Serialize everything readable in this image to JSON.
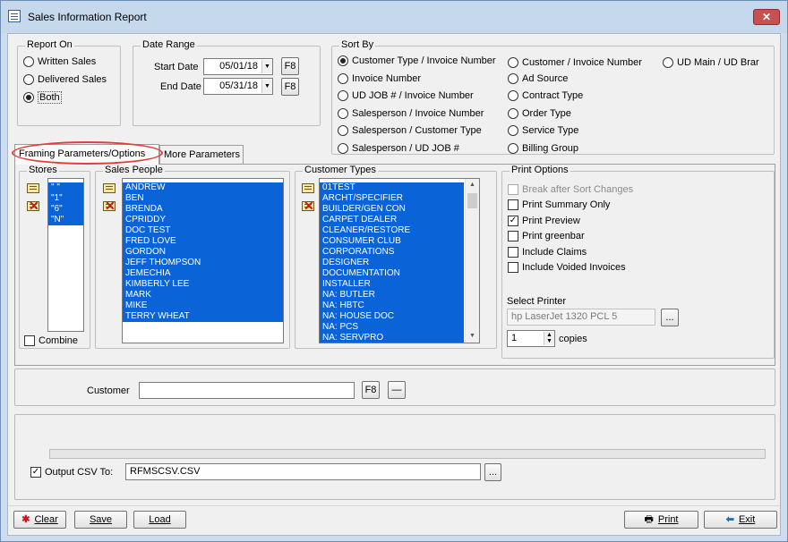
{
  "window": {
    "title": "Sales Information Report",
    "close_label": "✕"
  },
  "report_on": {
    "legend": "Report On",
    "options": [
      "Written Sales",
      "Delivered Sales",
      "Both"
    ],
    "selected": "Both"
  },
  "date_range": {
    "legend": "Date Range",
    "start_label": "Start Date",
    "start_value": "05/01/18",
    "end_label": "End Date",
    "end_value": "05/31/18",
    "lookup_label": "F8"
  },
  "sort_by": {
    "legend": "Sort By",
    "col1": [
      "Customer Type / Invoice Number",
      "Invoice Number",
      "UD JOB # / Invoice Number",
      "Salesperson / Invoice Number",
      "Salesperson / Customer Type",
      "Salesperson / UD JOB #"
    ],
    "col2": [
      "Customer / Invoice Number",
      "Ad Source",
      "Contract Type",
      "Order Type",
      "Service Type",
      "Billing Group"
    ],
    "col3": [
      "UD Main / UD Brar"
    ],
    "selected": "Customer Type / Invoice Number"
  },
  "tabs": {
    "active": "Framing Parameters/Options",
    "other": "More Parameters"
  },
  "stores": {
    "legend": "Stores",
    "items": [
      "\" \"",
      "\"1\"",
      "\"6\"",
      "\"N\""
    ],
    "combine_label": "Combine"
  },
  "sales_people": {
    "legend": "Sales People",
    "items": [
      "ANDREW",
      "BEN",
      "BRENDA",
      "CPRIDDY",
      "DOC TEST",
      "FRED LOVE",
      "GORDON",
      "JEFF THOMPSON",
      "JEMECHIA",
      "KIMBERLY LEE",
      "MARK",
      "MIKE",
      "TERRY WHEAT"
    ]
  },
  "customer_types": {
    "legend": "Customer Types",
    "items": [
      "01TEST",
      "ARCHT/SPECIFIER",
      "BUILDER/GEN CON",
      "CARPET DEALER",
      "CLEANER/RESTORE",
      "CONSUMER CLUB",
      "CORPORATIONS",
      "DESIGNER",
      "DOCUMENTATION",
      "INSTALLER",
      "NA: BUTLER",
      "NA: HBTC",
      "NA: HOUSE DOC",
      "NA: PCS",
      "NA: SERVPRO"
    ]
  },
  "print_options": {
    "legend": "Print Options",
    "break_after_sort": "Break after Sort Changes",
    "summary_only": "Print Summary Only",
    "preview": "Print Preview",
    "greenbar": "Print greenbar",
    "claims": "Include Claims",
    "voided": "Include Voided Invoices",
    "check_mark": "✓",
    "select_printer_label": "Select Printer",
    "printer_value": "hp LaserJet 1320 PCL 5",
    "browse_label": "...",
    "copies_value": "1",
    "copies_label": "copies"
  },
  "customer": {
    "label": "Customer",
    "value": "",
    "lookup_label": "F8",
    "clear_label": "—"
  },
  "output_csv": {
    "label": "Output CSV To:",
    "value": "RFMSCSV.CSV",
    "browse_label": "..."
  },
  "buttons": {
    "clear": "Clear",
    "save": "Save",
    "load": "Load",
    "print": "Print",
    "exit": "Exit"
  }
}
